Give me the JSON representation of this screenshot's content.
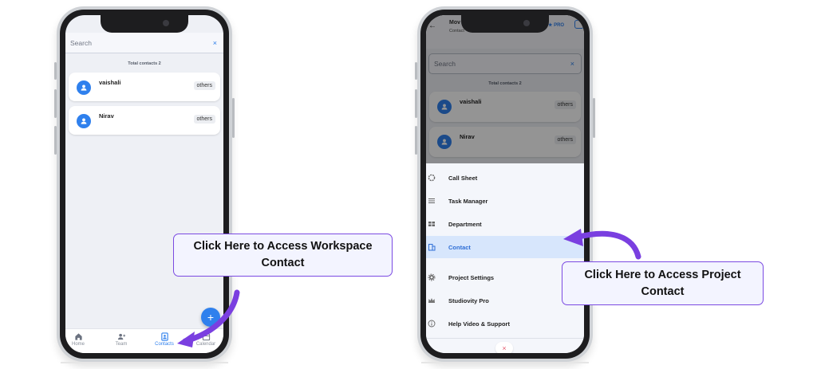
{
  "left_phone": {
    "search_placeholder": "Search",
    "search_clear": "×",
    "total_contacts": "Total contacts 2",
    "contacts": [
      {
        "name": "vaishali",
        "tag": "others"
      },
      {
        "name": "Nirav",
        "tag": "others"
      }
    ],
    "fab_label": "+",
    "nav": [
      {
        "label": "Home",
        "icon": "home-icon"
      },
      {
        "label": "Team",
        "icon": "team-icon"
      },
      {
        "label": "Contacts",
        "icon": "contacts-icon",
        "active": true
      },
      {
        "label": "Calendar",
        "icon": "calendar-icon"
      }
    ]
  },
  "left_callout": "Click Here to Access Workspace Contact",
  "right_phone": {
    "header_title": "Mov",
    "header_subtitle": "Contact",
    "pro_label": "PRO",
    "search_placeholder": "Search",
    "search_clear": "×",
    "total_contacts": "Total contacts 2",
    "contacts": [
      {
        "name": "vaishali",
        "tag": "others"
      },
      {
        "name": "Nirav",
        "tag": "others"
      }
    ],
    "menu": [
      {
        "label": "Call Sheet",
        "icon": "clapper-icon"
      },
      {
        "label": "Task Manager",
        "icon": "list-icon"
      },
      {
        "label": "Department",
        "icon": "grid-icon"
      },
      {
        "label": "Contact",
        "icon": "building-icon",
        "active": true
      },
      {
        "label": "Project Settings",
        "icon": "gear-icon"
      },
      {
        "label": "Studiovity Pro",
        "icon": "crown-icon"
      },
      {
        "label": "Help Video & Support",
        "icon": "info-icon"
      }
    ],
    "close_label": "×"
  },
  "right_callout": "Click Here to Access Project Contact",
  "colors": {
    "accent": "#2f80ed",
    "callout_border": "#7b4ae2",
    "arrow": "#7a3fe0",
    "active_menu_bg": "#d7e6fc"
  }
}
